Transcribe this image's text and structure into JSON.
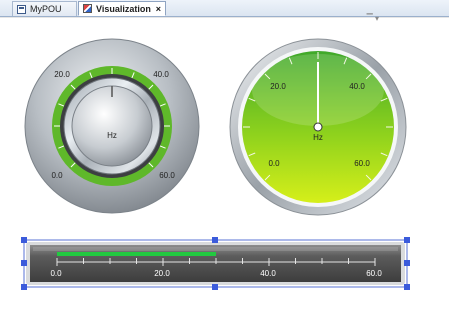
{
  "tabs": [
    {
      "label": "MyPOU",
      "active": false,
      "icon": "pou-icon"
    },
    {
      "label": "Visualization",
      "active": true,
      "icon": "visualization-icon",
      "close": "×"
    }
  ],
  "knob": {
    "unit": "Hz",
    "scale_labels": [
      "0.0",
      "20.0",
      "40.0",
      "60.0"
    ],
    "min": 0,
    "max": 60,
    "value": 30,
    "colors": {
      "ring": "#6ec52a",
      "face": "#c8cdd2"
    }
  },
  "meter": {
    "unit": "Hz",
    "scale_labels": [
      "0.0",
      "20.0",
      "40.0",
      "60.0"
    ],
    "min": 0,
    "max": 60,
    "value": 30,
    "colors": {
      "face_top": "#3fa82a",
      "face_bottom": "#d6ef1a",
      "needle": "#ffffff"
    }
  },
  "bar": {
    "scale_labels": [
      "0.0",
      "20.0",
      "40.0",
      "60.0"
    ],
    "min": 0,
    "max": 60,
    "value": 30,
    "colors": {
      "bar": "#22c940",
      "body": "#5a5a5a",
      "handle": "#3b5bdb"
    }
  }
}
